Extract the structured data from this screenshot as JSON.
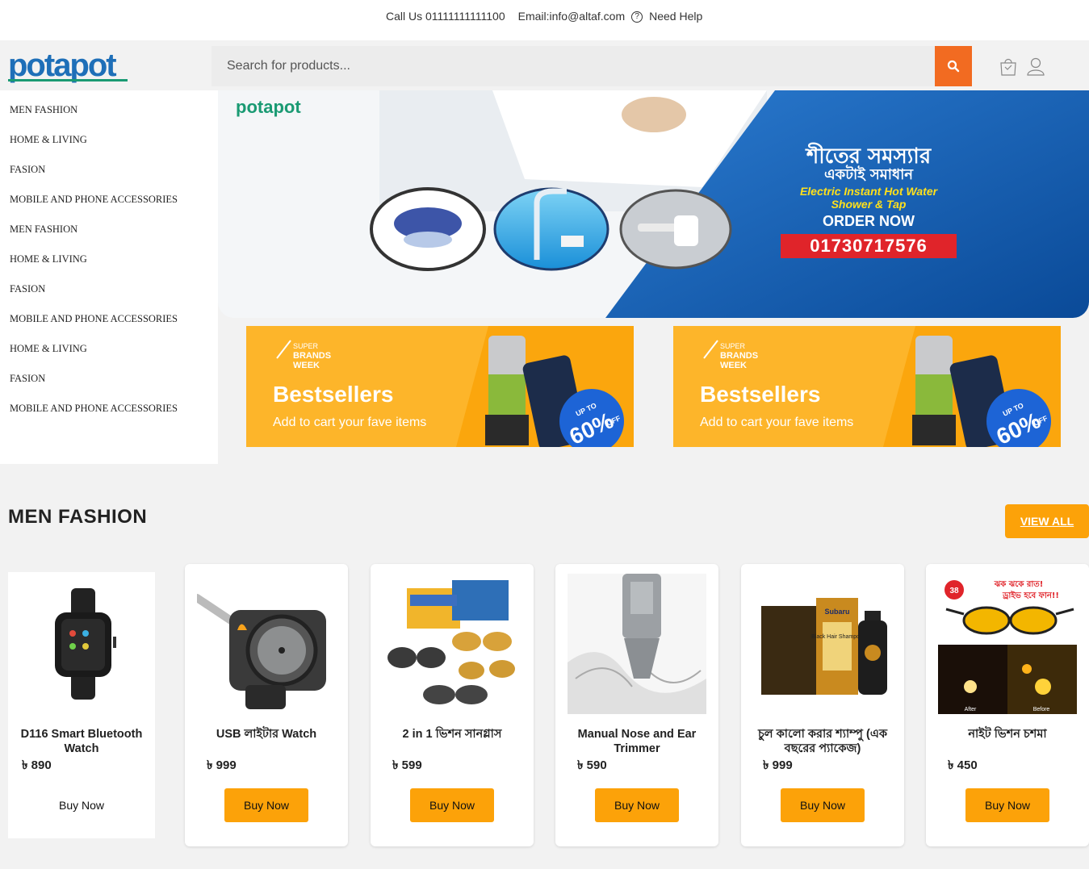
{
  "topbar": {
    "call": "Call Us 01111111111100",
    "email": "Email:info@altaf.com",
    "help": "Need Help"
  },
  "header": {
    "logo_text": "potapot",
    "search_placeholder": "Search for products...",
    "icons": [
      "search-icon",
      "shopping-bag-icon",
      "user-icon"
    ]
  },
  "sidebar": {
    "items": [
      "MEN FASHION",
      "HOME & LIVING",
      "FASION",
      "MOBILE AND PHONE ACCESSORIES",
      "MEN FASHION",
      "HOME & LIVING",
      "FASION",
      "MOBILE AND PHONE ACCESSORIES",
      "HOME & LIVING",
      "FASION",
      "MOBILE AND PHONE ACCESSORIES"
    ]
  },
  "hero": {
    "logo": "potapot",
    "line1": "শীতের সমস্যার",
    "line2": "একটাই সমাধান",
    "line3": "Electric Instant Hot Water",
    "line4": "Shower & Tap",
    "cta": "ORDER NOW",
    "phone": "01730717576"
  },
  "promos": [
    {
      "tag1": "SUPER",
      "tag2": "BRANDS",
      "tag3": "WEEK",
      "title": "Bestsellers",
      "subtitle": "Add to cart your fave items",
      "badge_top": "UP TO",
      "badge_value": "60%",
      "badge_bottom": "OFF"
    },
    {
      "tag1": "SUPER",
      "tag2": "BRANDS",
      "tag3": "WEEK",
      "title": "Bestsellers",
      "subtitle": "Add to cart your fave items",
      "badge_top": "UP TO",
      "badge_value": "60%",
      "badge_bottom": "OFF"
    }
  ],
  "section": {
    "title": "MEN FASHION",
    "view_all": "VIEW ALL"
  },
  "products": [
    {
      "name": "D116 Smart Bluetooth Watch",
      "price": "৳ 890",
      "buy": "Buy Now"
    },
    {
      "name": "USB লাইটার Watch",
      "price": "৳ 999",
      "buy": "Buy Now"
    },
    {
      "name": "2 in 1 ভিশন সানগ্লাস",
      "price": "৳ 599",
      "buy": "Buy Now"
    },
    {
      "name": "Manual Nose and Ear Trimmer",
      "price": "৳ 590",
      "buy": "Buy Now"
    },
    {
      "name": "চুল কালো করার শ্যাম্পু (এক বছরের প্যাকেজ)",
      "price": "৳ 999",
      "buy": "Buy Now"
    },
    {
      "name": "নাইট ভিশন চশমা",
      "price": "৳ 450",
      "buy": "Buy Now",
      "img_text1": "ঝক ঝকে রাত!",
      "img_text2": "ড্রাইভ হবে ফান!!",
      "img_badge": "38",
      "img_left": "After",
      "img_right": "Before"
    }
  ],
  "product_images": {
    "subaru_brand": "Subaru",
    "subaru_label": "Black Hair Shampoo"
  },
  "colors": {
    "accent": "#f26b21",
    "button": "#fca209",
    "brand_green": "#1a9a73",
    "brand_blue": "#1e6fb8",
    "hero_red": "#e0242a"
  }
}
